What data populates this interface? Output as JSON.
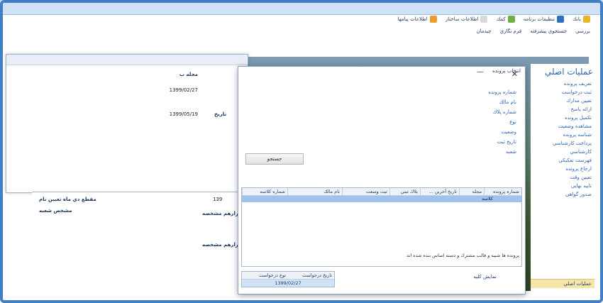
{
  "toolbar": {
    "row1": [
      "بانك",
      "تنظيمات برنامه",
      "كمك",
      "اطلاعات ساختار",
      "كسب و كار",
      "مساعدت",
      "اطلاعات پيامها"
    ],
    "row2": [
      "بررسي",
      "جستجوي پيشرفته",
      "فرم نگاري",
      "چيدمان",
      "ميانبر"
    ]
  },
  "back_window": {
    "title": "",
    "fields": [
      {
        "label": "مجله ب",
        "value": "1399/02/27"
      },
      {
        "label": "تاریخ",
        "value": "1399/05/19"
      }
    ]
  },
  "lower_panel": {
    "fields": [
      {
        "label": "مقطع دي ماه تعیین نام",
        "value": "139"
      },
      {
        "label": "مشخص شعبه",
        "value": "فرارهم مشخصه"
      },
      {
        "label": "شماره پرونده",
        "value": "فرارهم مشخصه"
      }
    ]
  },
  "sidebar": {
    "title": "عمليات اصلي",
    "items": [
      "تعریف پرونده",
      "ثبت درخواست",
      "تعيين مدارك",
      "ارائه پاسخ",
      "تكميل پرونده",
      "مشاهده وضعیت",
      "شناسه پرونده",
      "پرداخت كارشناسي",
      "كارشناسي",
      "فهرست تفكيكي",
      "ارجاع پرونده",
      "تعیین وقت",
      "تایید نهایی",
      "صدور گواهی"
    ],
    "footer": "عمليات اصلي"
  },
  "dialog": {
    "title": "انتخاب پرونده",
    "criteria": [
      "شماره پرونده",
      "نام مالك",
      "شماره پلاك",
      "نوع",
      "وضعیت",
      "تاریخ ثبت",
      "شعبه"
    ],
    "search_button": "جستجو",
    "grid": {
      "columns": [
        "شماره پرونده",
        "مجله",
        "تاريخ آخرين ...",
        "بلاك ثبتي",
        "ثبت وسعت",
        "نام مالك",
        "شماره كلاسه"
      ],
      "selected_row_text": "كلاسه"
    },
    "note": "پرونده ها شبيه و قالب مشترك و دسته اساس بنده شده اند",
    "checkbox_label": "نمايش كليه",
    "date_table": {
      "headers": [
        "تاريخ درخواست",
        "نوع درخواست"
      ],
      "value": "1399/02/27"
    }
  }
}
